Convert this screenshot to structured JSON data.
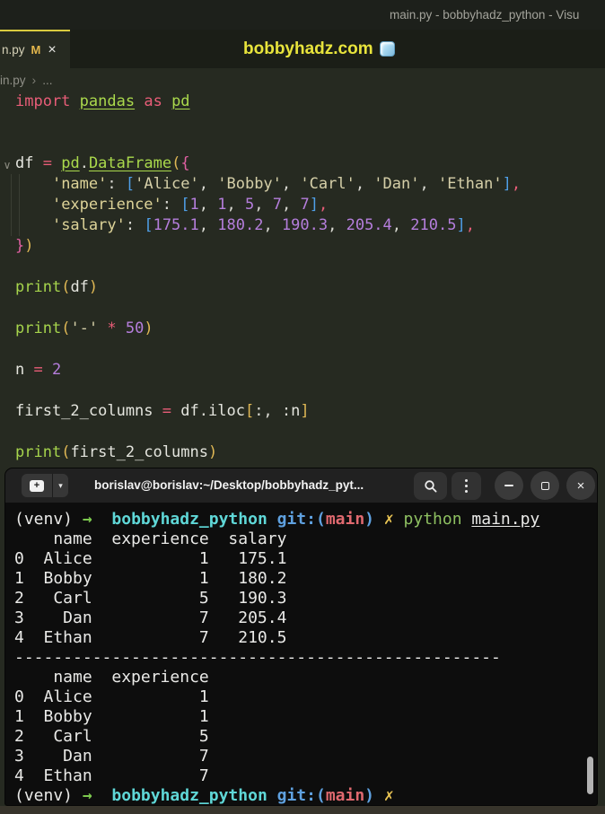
{
  "titlebar": {
    "title": "main.py - bobbyhadz_python - Visu"
  },
  "tabbar": {
    "tab": {
      "label": "n.py",
      "modified_badge": "M"
    },
    "watermark": "bobbyhadz.com"
  },
  "breadcrumb": {
    "file": "in.py",
    "sep": "›",
    "more": "..."
  },
  "icons": {
    "close": "×",
    "caret_down": "▾",
    "fold": "∨",
    "plus": "+"
  },
  "colors": {
    "accent_yellow": "#d9cb3f",
    "watermark_yellow": "#e8e43c",
    "editor_bg": "#262a21",
    "titlebar_bg": "#1d201b",
    "tabbar_bg": "#1b1e17",
    "terminal_bg": "#0d0d0d",
    "terminal_header_bg": "#212121",
    "keyword_pink": "#e85d78",
    "import_green": "#aad94c",
    "number_purple": "#b57edc",
    "string_cream": "#d5cfa8",
    "bracket_gold": "#e0b855",
    "bracket_pink": "#e060a2",
    "bracket_blue": "#4f9fe8",
    "prompt_arrow_green": "#7cc84e",
    "prompt_dir_cyan": "#5fd7d7",
    "git_blue": "#5fa1e0",
    "git_branch_red": "#e0696f",
    "dirty_yellow": "#eac554",
    "command_green": "#8ec061"
  },
  "editor": {
    "lines": [
      [
        {
          "t": "import ",
          "c": "kw"
        },
        {
          "t": "pandas",
          "c": "mod"
        },
        {
          "t": " ",
          "c": "txt"
        },
        {
          "t": "as",
          "c": "kw"
        },
        {
          "t": " ",
          "c": "txt"
        },
        {
          "t": "pd",
          "c": "mod"
        }
      ],
      [],
      [],
      [
        {
          "t": "df ",
          "c": "var"
        },
        {
          "t": "= ",
          "c": "op"
        },
        {
          "t": "pd",
          "c": "mod"
        },
        {
          "t": ".",
          "c": "txt"
        },
        {
          "t": "DataFrame",
          "c": "mod"
        },
        {
          "t": "(",
          "c": "b1"
        },
        {
          "t": "{",
          "c": "b2"
        }
      ],
      [
        {
          "t": "    ",
          "c": "txt"
        },
        {
          "t": "'name'",
          "c": "key"
        },
        {
          "t": ": ",
          "c": "txt"
        },
        {
          "t": "[",
          "c": "b3"
        },
        {
          "t": "'Alice'",
          "c": "str"
        },
        {
          "t": ", ",
          "c": "txt"
        },
        {
          "t": "'Bobby'",
          "c": "str"
        },
        {
          "t": ", ",
          "c": "txt"
        },
        {
          "t": "'Carl'",
          "c": "str"
        },
        {
          "t": ", ",
          "c": "txt"
        },
        {
          "t": "'Dan'",
          "c": "str"
        },
        {
          "t": ", ",
          "c": "txt"
        },
        {
          "t": "'Ethan'",
          "c": "str"
        },
        {
          "t": "]",
          "c": "b3"
        },
        {
          "t": ",",
          "c": "com"
        }
      ],
      [
        {
          "t": "    ",
          "c": "txt"
        },
        {
          "t": "'experience'",
          "c": "key"
        },
        {
          "t": ": ",
          "c": "txt"
        },
        {
          "t": "[",
          "c": "b3"
        },
        {
          "t": "1",
          "c": "num"
        },
        {
          "t": ", ",
          "c": "txt"
        },
        {
          "t": "1",
          "c": "num"
        },
        {
          "t": ", ",
          "c": "txt"
        },
        {
          "t": "5",
          "c": "num"
        },
        {
          "t": ", ",
          "c": "txt"
        },
        {
          "t": "7",
          "c": "num"
        },
        {
          "t": ", ",
          "c": "txt"
        },
        {
          "t": "7",
          "c": "num"
        },
        {
          "t": "]",
          "c": "b3"
        },
        {
          "t": ",",
          "c": "com"
        }
      ],
      [
        {
          "t": "    ",
          "c": "txt"
        },
        {
          "t": "'salary'",
          "c": "key"
        },
        {
          "t": ": ",
          "c": "txt"
        },
        {
          "t": "[",
          "c": "b3"
        },
        {
          "t": "175.1",
          "c": "num"
        },
        {
          "t": ", ",
          "c": "txt"
        },
        {
          "t": "180.2",
          "c": "num"
        },
        {
          "t": ", ",
          "c": "txt"
        },
        {
          "t": "190.3",
          "c": "num"
        },
        {
          "t": ", ",
          "c": "txt"
        },
        {
          "t": "205.4",
          "c": "num"
        },
        {
          "t": ", ",
          "c": "txt"
        },
        {
          "t": "210.5",
          "c": "num"
        },
        {
          "t": "]",
          "c": "b3"
        },
        {
          "t": ",",
          "c": "com"
        }
      ],
      [
        {
          "t": "}",
          "c": "b2"
        },
        {
          "t": ")",
          "c": "b1"
        }
      ],
      [],
      [
        {
          "t": "print",
          "c": "fn"
        },
        {
          "t": "(",
          "c": "b1"
        },
        {
          "t": "df",
          "c": "var"
        },
        {
          "t": ")",
          "c": "b1"
        }
      ],
      [],
      [
        {
          "t": "print",
          "c": "fn"
        },
        {
          "t": "(",
          "c": "b1"
        },
        {
          "t": "'-'",
          "c": "str"
        },
        {
          "t": " ",
          "c": "txt"
        },
        {
          "t": "*",
          "c": "op"
        },
        {
          "t": " ",
          "c": "txt"
        },
        {
          "t": "50",
          "c": "num"
        },
        {
          "t": ")",
          "c": "b1"
        }
      ],
      [],
      [
        {
          "t": "n ",
          "c": "var"
        },
        {
          "t": "= ",
          "c": "op"
        },
        {
          "t": "2",
          "c": "num"
        }
      ],
      [],
      [
        {
          "t": "first_2_columns ",
          "c": "var"
        },
        {
          "t": "= ",
          "c": "op"
        },
        {
          "t": "df",
          "c": "var"
        },
        {
          "t": ".",
          "c": "txt"
        },
        {
          "t": "iloc",
          "c": "var"
        },
        {
          "t": "[",
          "c": "b1"
        },
        {
          "t": ":, :",
          "c": "txt"
        },
        {
          "t": "n",
          "c": "var"
        },
        {
          "t": "]",
          "c": "b1"
        }
      ],
      [],
      [
        {
          "t": "print",
          "c": "fn"
        },
        {
          "t": "(",
          "c": "b1"
        },
        {
          "t": "first_2_columns",
          "c": "var"
        },
        {
          "t": ")",
          "c": "b1"
        }
      ]
    ]
  },
  "terminal": {
    "header": {
      "title": "borislav@borislav:~/Desktop/bobbyhadz_pyt..."
    },
    "lines": [
      [
        {
          "t": "(venv) ",
          "c": "p"
        },
        {
          "t": "→",
          "c": "arrow"
        },
        {
          "t": "  ",
          "c": "p"
        },
        {
          "t": "bobbyhadz_python",
          "c": "dir"
        },
        {
          "t": " ",
          "c": "p"
        },
        {
          "t": "git:(",
          "c": "gb"
        },
        {
          "t": "main",
          "c": "gr"
        },
        {
          "t": ")",
          "c": "gb"
        },
        {
          "t": " ",
          "c": "p"
        },
        {
          "t": "✗",
          "c": "gx"
        },
        {
          "t": " ",
          "c": "p"
        },
        {
          "t": "python ",
          "c": "cmd"
        },
        {
          "t": "main.py",
          "c": "arg"
        }
      ],
      [
        {
          "t": "    name  experience  salary",
          "c": "p"
        }
      ],
      [
        {
          "t": "0  Alice           1   175.1",
          "c": "p"
        }
      ],
      [
        {
          "t": "1  Bobby           1   180.2",
          "c": "p"
        }
      ],
      [
        {
          "t": "2   Carl           5   190.3",
          "c": "p"
        }
      ],
      [
        {
          "t": "3    Dan           7   205.4",
          "c": "p"
        }
      ],
      [
        {
          "t": "4  Ethan           7   210.5",
          "c": "p"
        }
      ],
      [
        {
          "t": "--------------------------------------------------",
          "c": "p"
        }
      ],
      [
        {
          "t": "    name  experience",
          "c": "p"
        }
      ],
      [
        {
          "t": "0  Alice           1",
          "c": "p"
        }
      ],
      [
        {
          "t": "1  Bobby           1",
          "c": "p"
        }
      ],
      [
        {
          "t": "2   Carl           5",
          "c": "p"
        }
      ],
      [
        {
          "t": "3    Dan           7",
          "c": "p"
        }
      ],
      [
        {
          "t": "4  Ethan           7",
          "c": "p"
        }
      ],
      [
        {
          "t": "(venv) ",
          "c": "p"
        },
        {
          "t": "→",
          "c": "arrow"
        },
        {
          "t": "  ",
          "c": "p"
        },
        {
          "t": "bobbyhadz_python",
          "c": "dir"
        },
        {
          "t": " ",
          "c": "p"
        },
        {
          "t": "git:(",
          "c": "gb"
        },
        {
          "t": "main",
          "c": "gr"
        },
        {
          "t": ")",
          "c": "gb"
        },
        {
          "t": " ",
          "c": "p"
        },
        {
          "t": "✗",
          "c": "gx"
        }
      ]
    ]
  }
}
